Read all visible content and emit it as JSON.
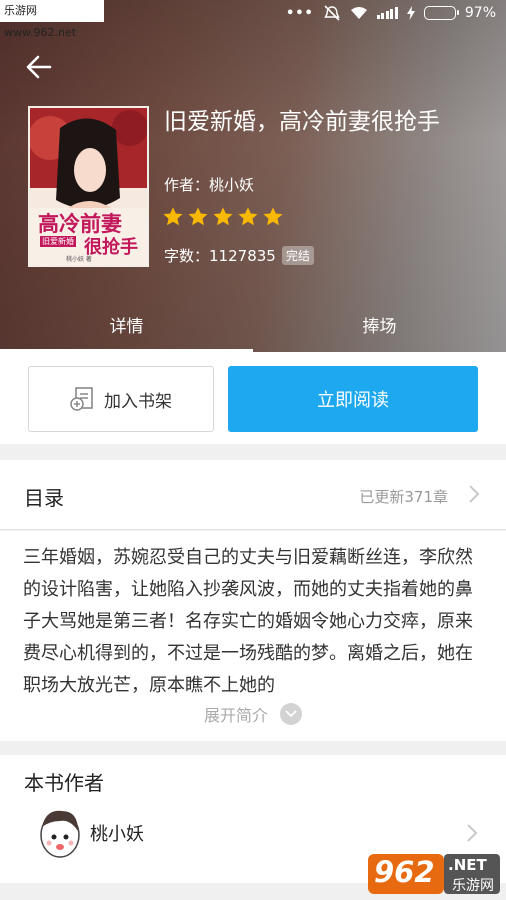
{
  "watermark": "乐游网 www.962.net",
  "status": {
    "battery": "97%",
    "battery_level": 0.97
  },
  "book": {
    "title": "旧爱新婚，高冷前妻很抢手",
    "author_label": "作者：",
    "author": "桃小妖",
    "rating_stars": 5,
    "words_label": "字数：",
    "words": "1127835",
    "status_tag": "完结",
    "cover": {
      "title": "高冷前妻",
      "title2": "很抢手",
      "subtitle": "旧爱新婚",
      "author": "桃小妖 著"
    }
  },
  "tabs": [
    {
      "label": "详情",
      "active": true
    },
    {
      "label": "捧场",
      "active": false
    }
  ],
  "actions": {
    "shelf_label": "加入书架",
    "read_label": "立即阅读"
  },
  "catalog": {
    "title": "目录",
    "updated": "已更新371章"
  },
  "intro": {
    "text": "三年婚姻，苏婉忍受自己的丈夫与旧爱藕断丝连，李欣然的设计陷害，让她陷入抄袭风波，而她的丈夫指着她的鼻子大骂她是第三者！名存实亡的婚姻令她心力交瘁，原来费尽心机得到的，不过是一场残酷的梦。离婚之后，她在职场大放光芒，原本瞧不上她的",
    "expand_label": "展开简介"
  },
  "author_section": {
    "title": "本书作者",
    "name": "桃小妖"
  },
  "logo": {
    "text": "962",
    "suffix": ".NET",
    "sub": "乐游网"
  },
  "colors": {
    "accent": "#1ea8f0",
    "star": "#f9b800",
    "battery": "#4cd964"
  }
}
